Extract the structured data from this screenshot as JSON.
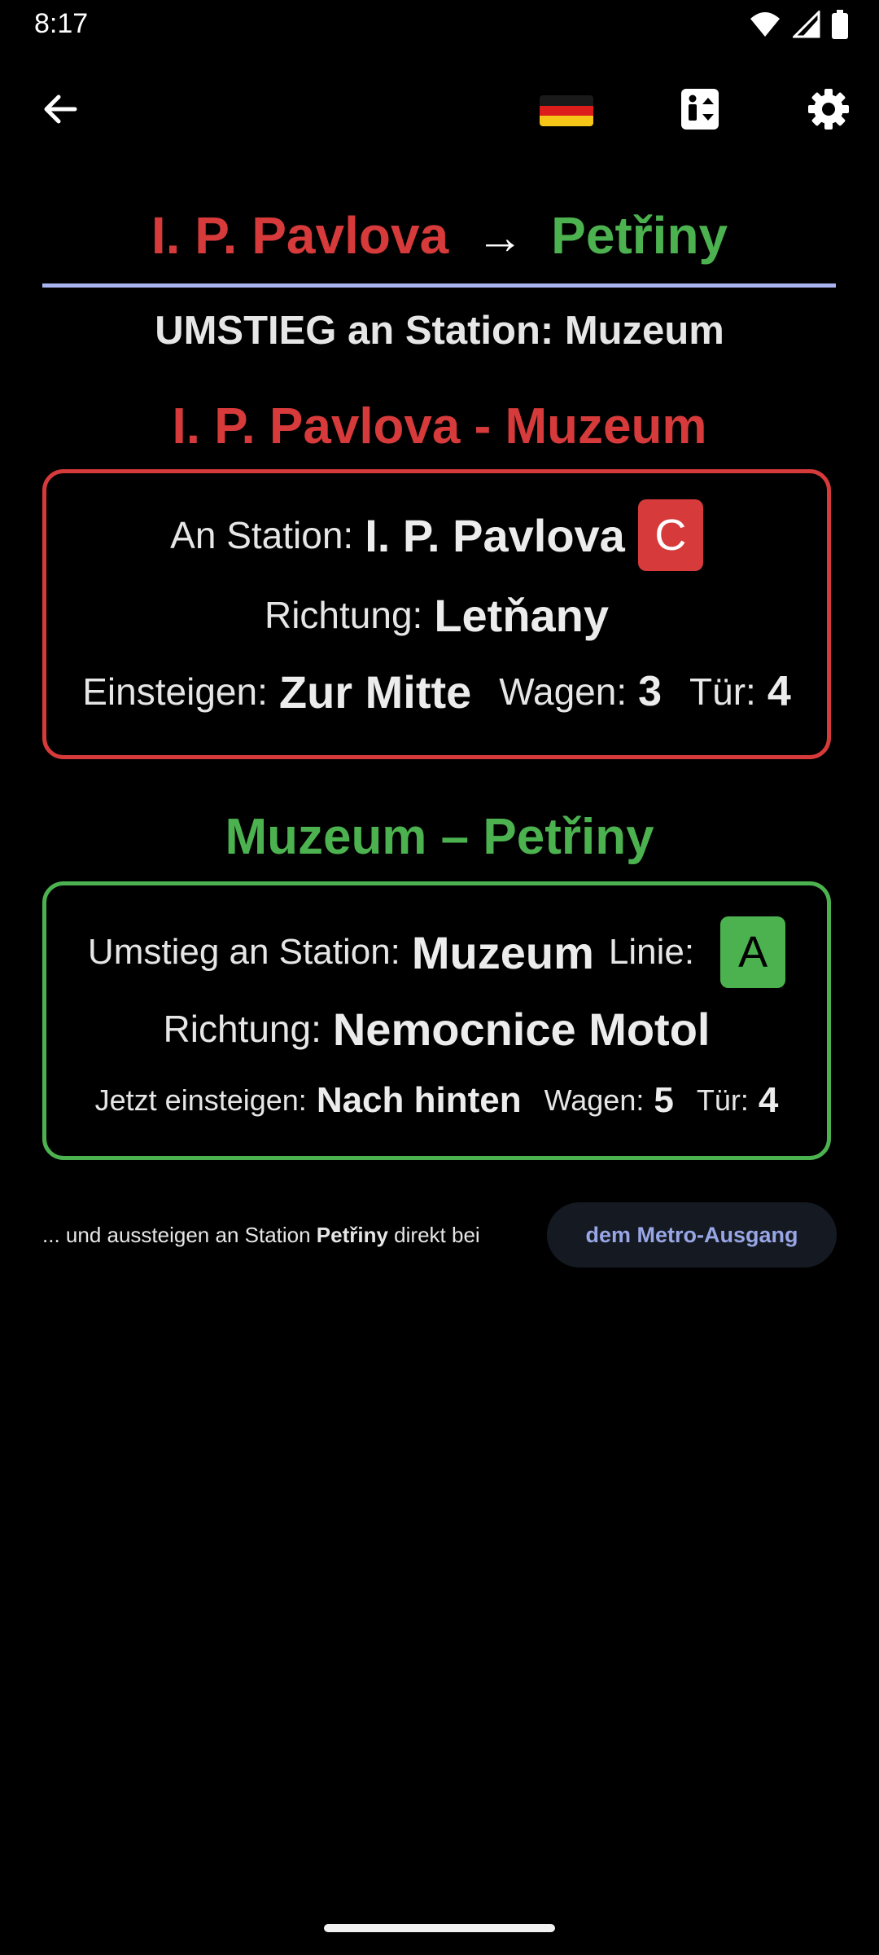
{
  "status_bar": {
    "time": "8:17",
    "icons": [
      "wifi-icon",
      "cell-signal-icon",
      "battery-icon"
    ]
  },
  "app_bar": {
    "icons": [
      "back-arrow-icon",
      "german-flag-icon",
      "elevator-icon",
      "settings-gear-icon"
    ]
  },
  "route": {
    "from": "I. P. Pavlova",
    "arrow": "→",
    "to": "Petřiny"
  },
  "transfer": {
    "label": "UMSTIEG an Station:",
    "station": "Muzeum"
  },
  "segment1": {
    "title": "I. P. Pavlova - Muzeum",
    "station_label": "An Station:",
    "station": "I. P. Pavlova",
    "line": "C",
    "direction_label": "Richtung:",
    "direction": "Letňany",
    "board_label": "Einsteigen:",
    "board": "Zur Mitte",
    "car_label": "Wagen:",
    "car": "3",
    "door_label": "Tür:",
    "door": "4"
  },
  "segment2": {
    "title": "Muzeum – Petřiny",
    "station_label": "Umstieg an Station:",
    "station": "Muzeum",
    "line_label": "Linie:",
    "line": "A",
    "direction_label": "Richtung:",
    "direction": "Nemocnice Motol",
    "board_label": "Jetzt einsteigen:",
    "board": "Nach hinten",
    "car_label": "Wagen:",
    "car": "5",
    "door_label": "Tür:",
    "door": "4"
  },
  "footer": {
    "prefix": "... und aussteigen an Station ",
    "station": "Petřiny",
    "suffix": " direkt bei",
    "exit_button": "dem Metro-Ausgang"
  },
  "colors": {
    "line_c": "#d63a3a",
    "line_a": "#4cb24f",
    "divider": "#aab4f0",
    "accent_button_text": "#98a6e6"
  }
}
